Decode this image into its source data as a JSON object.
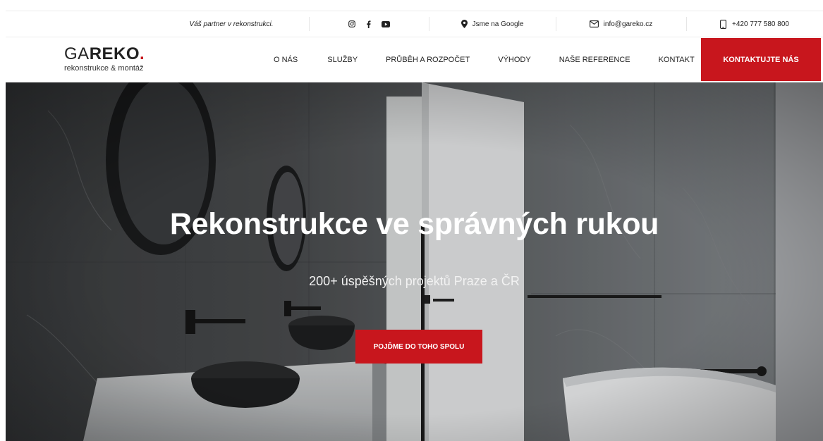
{
  "topbar": {
    "tagline": "Váš partner v rekonstrukci.",
    "social_icons": [
      "instagram-icon",
      "facebook-icon",
      "youtube-icon"
    ],
    "google_label": "Jsme na Google",
    "email": "info@gareko.cz",
    "phone": "+420 777 580 800"
  },
  "logo": {
    "part1": "GA",
    "part2": "REKO",
    "dot": ".",
    "subtitle": "rekonstrukce & montáž"
  },
  "nav": {
    "items": [
      "O NÁS",
      "SLUŽBY",
      "PRŮBĚH A ROZPOČET",
      "VÝHODY",
      "NAŠE REFERENCE",
      "KONTAKT"
    ],
    "cta": "KONTAKTUJTE NÁS"
  },
  "hero": {
    "title": "Rekonstrukce ve správných rukou",
    "subtitle": "200+ úspěšných projektů Praze a ČR",
    "cta": "POJĎME DO TOHO SPOLU"
  },
  "colors": {
    "accent": "#c8161d",
    "text": "#222222"
  }
}
